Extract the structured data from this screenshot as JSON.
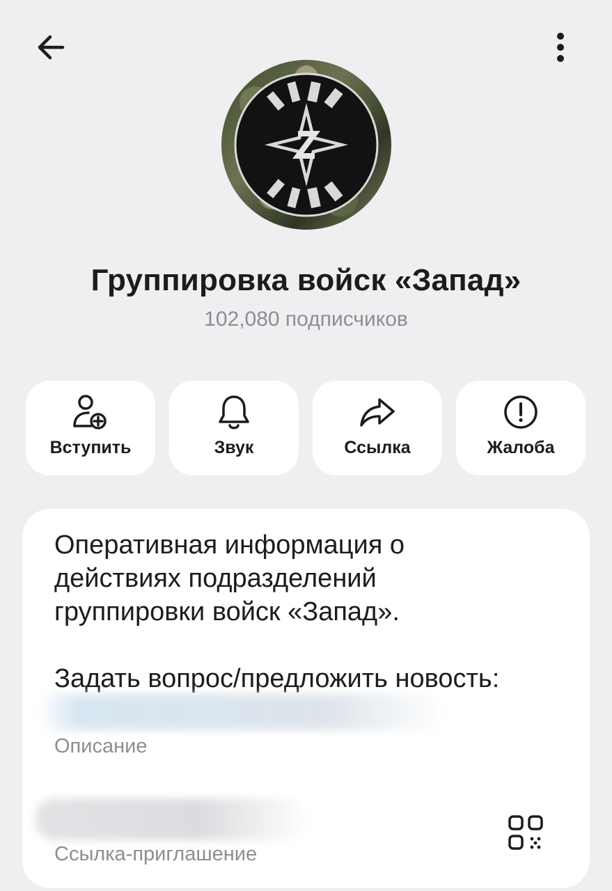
{
  "header": {
    "back_icon": "arrow-left-icon",
    "more_icon": "more-vertical-icon"
  },
  "channel": {
    "title": "Группировка войск «Запад»",
    "subscribers": "102,080 подписчиков"
  },
  "actions": [
    {
      "label": "Вступить",
      "icon": "user-plus-icon"
    },
    {
      "label": "Звук",
      "icon": "bell-icon"
    },
    {
      "label": "Ссылка",
      "icon": "share-arrow-icon"
    },
    {
      "label": "Жалоба",
      "icon": "alert-circle-icon"
    }
  ],
  "info": {
    "description_lines": [
      "Оперативная информация о",
      "действиях подразделений",
      "группировки войск «Запад».",
      "",
      "Задать вопрос/предложить новость:"
    ],
    "description_label": "Описание",
    "invite_label": "Ссылка-приглашение",
    "qr_icon": "qr-code-icon"
  },
  "colors": {
    "background": "#efeff1",
    "card": "#ffffff",
    "secondary_text": "#8d8d93"
  }
}
